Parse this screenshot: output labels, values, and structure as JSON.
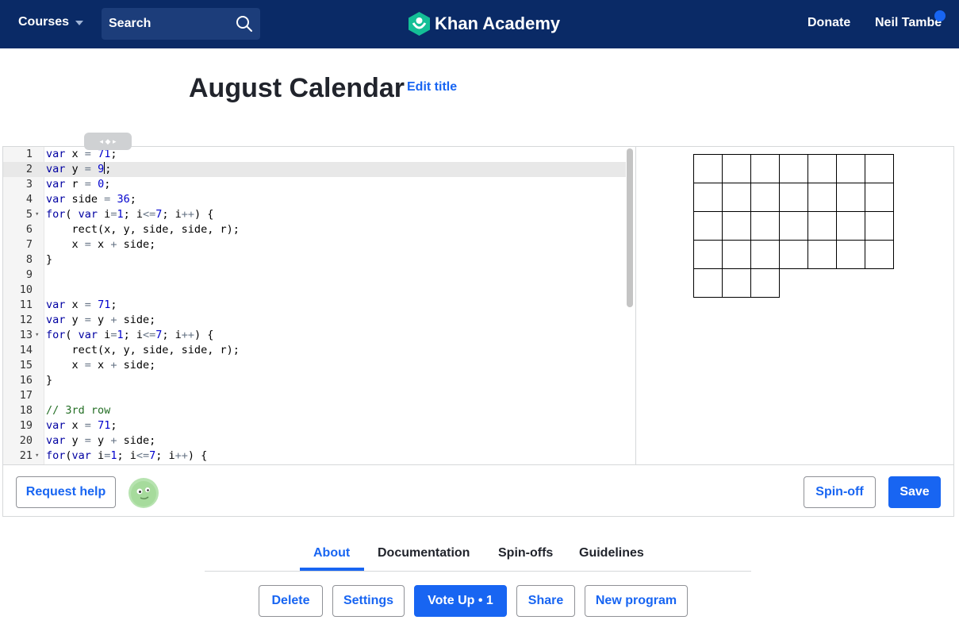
{
  "header": {
    "courses_label": "Courses",
    "search_placeholder": "Search",
    "brand": "Khan Academy",
    "donate": "Donate",
    "user_name": "Neil Tambe"
  },
  "program": {
    "title": "August Calendar",
    "edit_title": "Edit title"
  },
  "code": {
    "active_line": 2,
    "lines": [
      "var x = 71;",
      "var y = 9;",
      "var r = 0;",
      "var side = 36;",
      "for( var i=1; i<=7; i++) {",
      "    rect(x, y, side, side, r);",
      "    x = x + side;",
      "}",
      "",
      "",
      "var x = 71;",
      "var y = y + side;",
      "for( var i=1; i<=7; i++) {",
      "    rect(x, y, side, side, r);",
      "    x = x + side;",
      "}",
      "",
      "// 3rd row",
      "var x = 71;",
      "var y = y + side;",
      "for(var i=1; i<=7; i++) {"
    ]
  },
  "calendar": {
    "rows": 5,
    "cols": 7,
    "last_row_cells": 3
  },
  "editor_footer": {
    "request_help": "Request help",
    "spin_off": "Spin-off",
    "save": "Save"
  },
  "tabs": [
    {
      "label": "About",
      "active": true
    },
    {
      "label": "Documentation",
      "active": false
    },
    {
      "label": "Spin-offs",
      "active": false
    },
    {
      "label": "Guidelines",
      "active": false
    }
  ],
  "actions": {
    "delete": "Delete",
    "settings": "Settings",
    "vote_up": "Vote Up • 1",
    "share": "Share",
    "new_program": "New program"
  },
  "colors": {
    "nav_bg": "#0a2a66",
    "accent": "#1865f2",
    "brand_green": "#14bf96"
  }
}
